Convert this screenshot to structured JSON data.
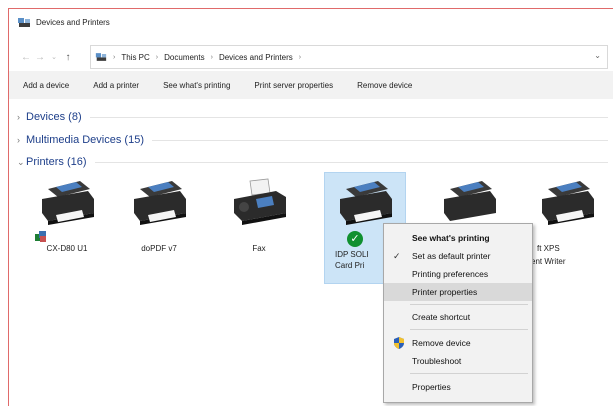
{
  "window": {
    "title": "Devices and Printers"
  },
  "address": {
    "crumbs": [
      "This PC",
      "Documents",
      "Devices and Printers"
    ]
  },
  "commands": [
    "Add a device",
    "Add a printer",
    "See what's printing",
    "Print server properties",
    "Remove device"
  ],
  "groups": {
    "devices": "Devices (8)",
    "multimedia": "Multimedia Devices (15)",
    "printers": "Printers (16)"
  },
  "printers": [
    {
      "label": "CX-D80 U1"
    },
    {
      "label": "doPDF v7"
    },
    {
      "label": "Fax"
    },
    {
      "label_line1": "IDP SOLI",
      "label_line2": "Card Pri"
    },
    {
      "label": ""
    },
    {
      "label_line1": "ft XPS",
      "label_line2": "ent Writer"
    }
  ],
  "context_menu": {
    "see_printing": "See what's printing",
    "set_default": "Set as default printer",
    "preferences": "Printing preferences",
    "printer_properties": "Printer properties",
    "create_shortcut": "Create shortcut",
    "remove_device": "Remove device",
    "troubleshoot": "Troubleshoot",
    "properties": "Properties"
  },
  "colors": {
    "selection": "#cce4f7",
    "group_text": "#1e3f8a",
    "menu_bg": "#f2f2f2",
    "default_check": "#109030"
  },
  "icons": {
    "app": "devices-printers-icon",
    "printer": "printer-icon",
    "fax": "fax-icon",
    "shield": "uac-shield-icon"
  }
}
